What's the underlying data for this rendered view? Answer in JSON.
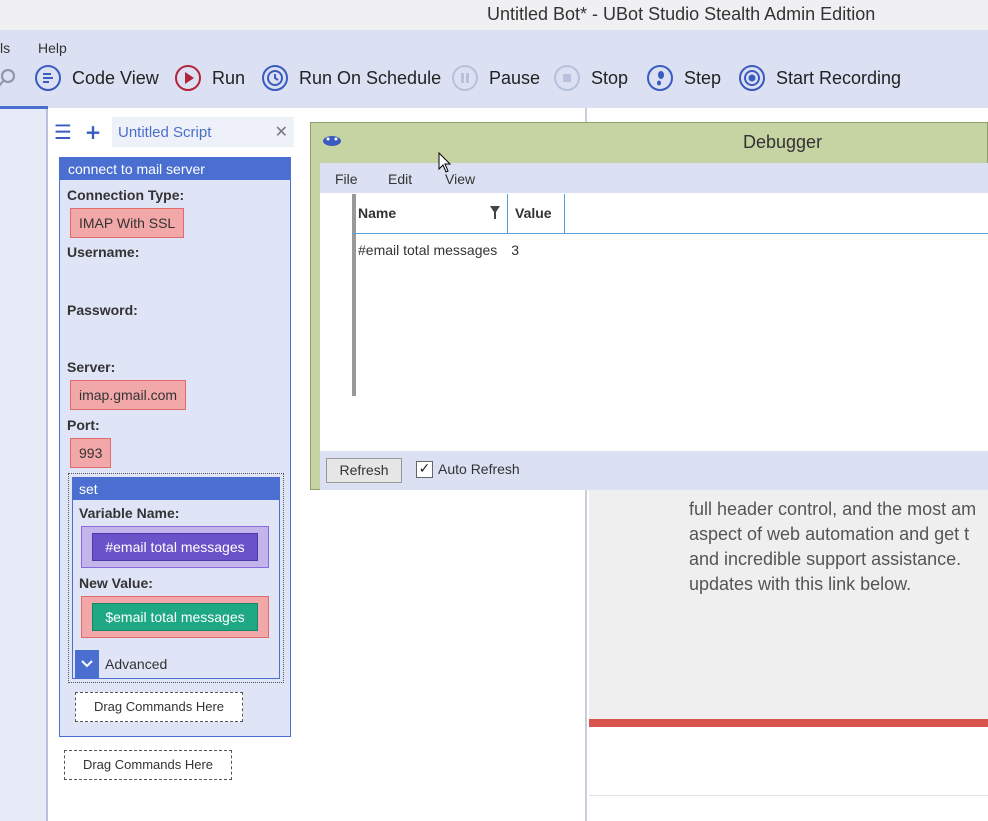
{
  "window": {
    "title": "Untitled Bot* - UBot Studio Stealth Admin Edition"
  },
  "menu": {
    "tools_partial": "ls",
    "help": "Help"
  },
  "toolbar": {
    "code_view": "Code View",
    "run": "Run",
    "run_on_schedule": "Run On Schedule",
    "pause": "Pause",
    "stop": "Stop",
    "step": "Step",
    "start_recording": "Start Recording"
  },
  "script_tab": {
    "label": "Untitled Script",
    "close": "✕"
  },
  "command": {
    "name": "connect to mail server",
    "connection_type_label": "Connection Type:",
    "connection_type_value": "IMAP With SSL",
    "username_label": "Username:",
    "password_label": "Password:",
    "server_label": "Server:",
    "server_value": "imap.gmail.com",
    "port_label": "Port:",
    "port_value": "993"
  },
  "set_command": {
    "name": "set",
    "variable_name_label": "Variable Name:",
    "variable_name_value": "#email total messages",
    "new_value_label": "New Value:",
    "new_value_value": "$email total messages",
    "advanced_label": "Advanced"
  },
  "drag_placeholder": "Drag Commands Here",
  "debugger": {
    "title": "Debugger",
    "menu": [
      "File",
      "Edit",
      "View"
    ],
    "columns": {
      "name": "Name",
      "value": "Value"
    },
    "rows": [
      {
        "name": "#email total messages",
        "value": "3"
      }
    ],
    "refresh_label": "Refresh",
    "auto_refresh_label": "Auto Refresh",
    "auto_refresh_checked": true
  },
  "browser": {
    "lines": [
      "full header control, and the most am",
      "aspect of web automation and get t",
      "and incredible support assistance.",
      "updates with this link below."
    ]
  },
  "colors": {
    "accent": "#4a6fd1",
    "run_red": "#b3243a",
    "toolbar_bg": "#dbe1f3",
    "debugger_title_bg": "#c6d4a4",
    "field_red": "#f2a8a8",
    "variable_purple": "#6a52c8",
    "variable_teal": "#1fa884"
  }
}
